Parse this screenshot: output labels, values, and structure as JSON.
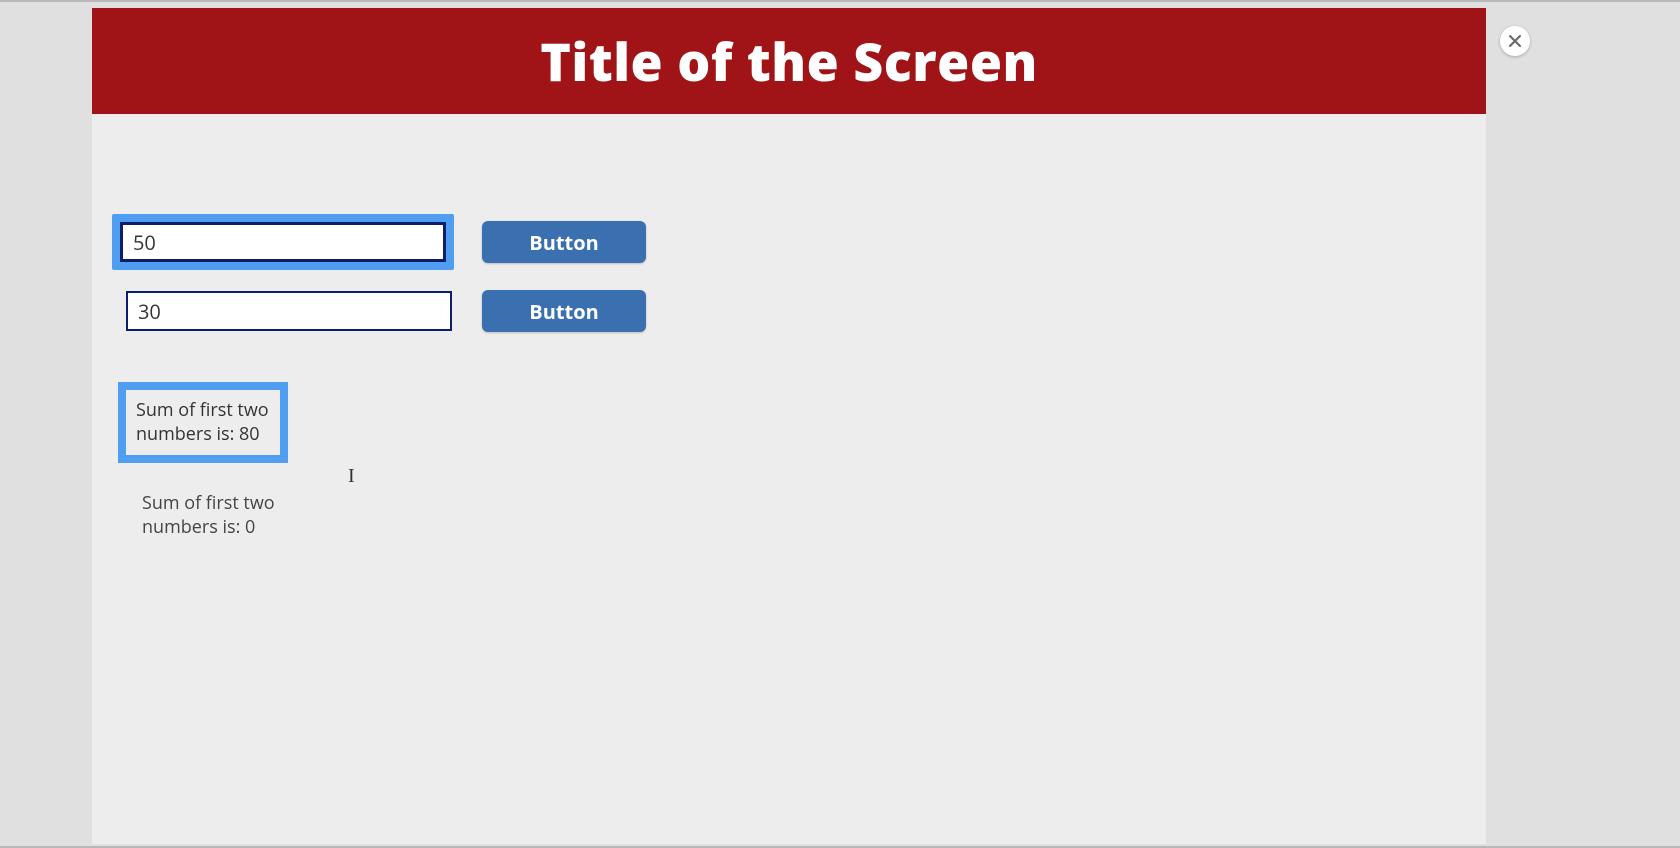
{
  "header": {
    "title": "Title of the Screen"
  },
  "inputs": {
    "first": {
      "value": "50"
    },
    "second": {
      "value": "30"
    }
  },
  "buttons": {
    "first": {
      "label": "Button"
    },
    "second": {
      "label": "Button"
    }
  },
  "results": {
    "highlighted": "Sum of first two numbers is: 80",
    "plain": "Sum of first two numbers is: 0"
  },
  "close": {
    "label": "×"
  },
  "colors": {
    "header_bg": "#a01316",
    "highlight": "#4f9ef2",
    "button_bg": "#3a6fb0",
    "input_border": "#0b1d6b"
  }
}
